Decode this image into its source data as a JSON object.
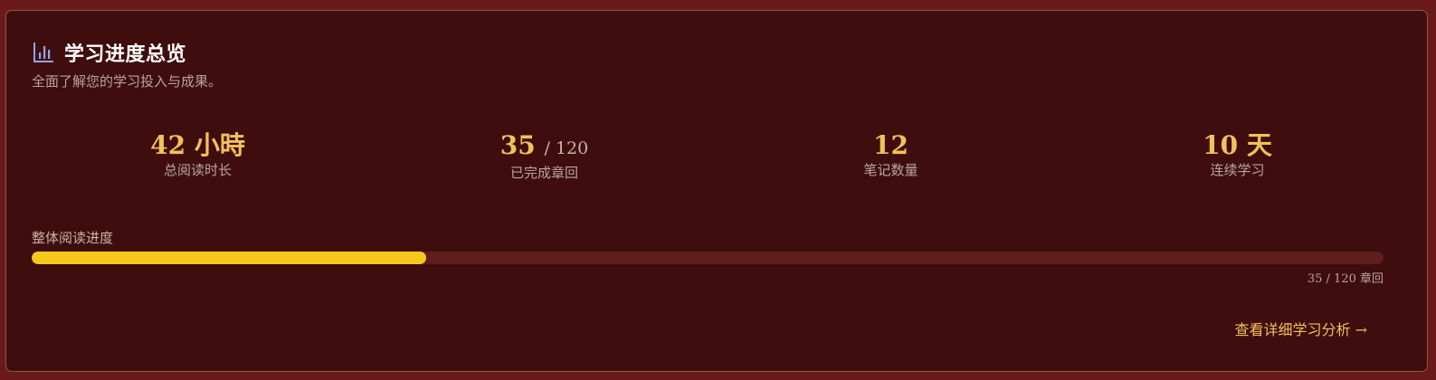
{
  "header": {
    "icon": "bar-chart-icon",
    "title": "学习进度总览",
    "subtitle": "全面了解您的学习投入与成果。"
  },
  "stats": [
    {
      "value": "42 小時",
      "label": "总阅读时长"
    },
    {
      "value": "35",
      "total": "/ 120",
      "label": "已完成章回"
    },
    {
      "value": "12",
      "label": "笔记数量"
    },
    {
      "value": "10 天",
      "label": "连续学习"
    }
  ],
  "progress": {
    "label": "整体阅读进度",
    "completed": 35,
    "total": 120,
    "caption": "35 / 120 章回",
    "fill_color": "#f6c71d"
  },
  "link": {
    "label": "查看详细学习分析 →"
  },
  "colors": {
    "background": "#6a1a1a",
    "card": "#3f0d0e",
    "accent": "#f2c15a"
  }
}
